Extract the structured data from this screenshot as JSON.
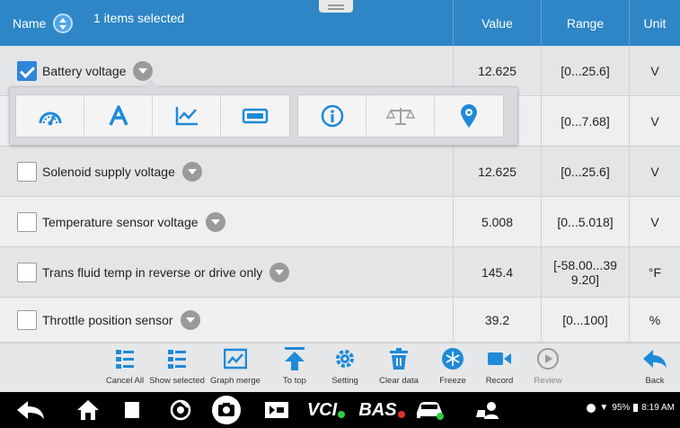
{
  "header": {
    "name_label": "Name",
    "selected_count": "1 items selected",
    "value_label": "Value",
    "range_label": "Range",
    "unit_label": "Unit"
  },
  "rows": [
    {
      "name": "Battery voltage",
      "value": "12.625",
      "range": "[0...25.6]",
      "unit": "V",
      "checked": true
    },
    {
      "name": "",
      "value": "",
      "range": "[0...7.68]",
      "unit": "V",
      "checked": false
    },
    {
      "name": "Solenoid supply voltage",
      "value": "12.625",
      "range": "[0...25.6]",
      "unit": "V",
      "checked": false
    },
    {
      "name": "Temperature sensor voltage",
      "value": "5.008",
      "range": "[0...5.018]",
      "unit": "V",
      "checked": false
    },
    {
      "name": "Trans fluid temp in reverse or drive only",
      "value": "145.4",
      "range": "[-58.00...39\n9.20]",
      "unit": "°F",
      "checked": false
    },
    {
      "name": "Throttle position sensor",
      "value": "39.2",
      "range": "[0...100]",
      "unit": "%",
      "checked": false
    }
  ],
  "popup_icons": [
    "gauge-icon",
    "text-mode-icon",
    "line-graph-icon",
    "digital-display-icon",
    "info-icon",
    "compare-scale-icon",
    "location-pin-icon"
  ],
  "toolbar": {
    "cancel_all": "Cancel All",
    "show_selected": "Show selected",
    "graph_merge": "Graph merge",
    "to_top": "To top",
    "setting": "Setting",
    "clear_data": "Clear data",
    "freeze": "Freeze",
    "record": "Record",
    "review": "Review",
    "back": "Back"
  },
  "navbar": {
    "vci": "VCI",
    "bas": "BAS",
    "battery": "95%",
    "time": "8:19 AM"
  },
  "colors": {
    "header_bg": "#2e86c6",
    "accent": "#2f86d8",
    "icon_blue": "#1f8ad8"
  }
}
